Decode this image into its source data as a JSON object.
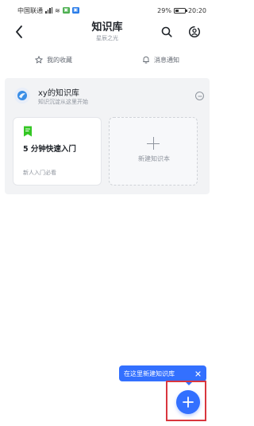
{
  "status_bar": {
    "carrier": "中国联通",
    "battery_percent": "29%",
    "time": "20:20"
  },
  "header": {
    "title": "知识库",
    "subtitle": "星辰之光"
  },
  "quick_links": [
    {
      "label": "我的收藏",
      "icon": "star-icon"
    },
    {
      "label": "消息通知",
      "icon": "bell-icon"
    }
  ],
  "knowledge_base": {
    "name": "xy的知识库",
    "description": "知识沉淀从这里开始",
    "cards": [
      {
        "title": "5 分钟快速入门",
        "subtitle": "新人入门必看",
        "icon": "document-icon",
        "icon_color": "#34c724"
      }
    ],
    "new_card_label": "新建知识本"
  },
  "tooltip": {
    "text": "在这里新建知识库"
  },
  "colors": {
    "accent": "#3370ff",
    "highlight": "#d9363e",
    "doc_icon": "#34c724"
  }
}
